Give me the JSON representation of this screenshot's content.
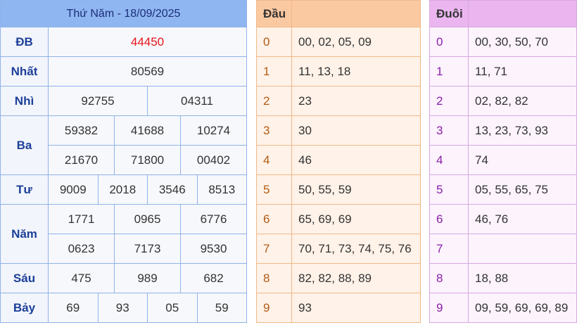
{
  "results": {
    "title": "Thứ Năm - 18/09/2025",
    "rows": [
      {
        "label": "ĐB",
        "values": [
          "44450"
        ]
      },
      {
        "label": "Nhất",
        "values": [
          "80569"
        ]
      },
      {
        "label": "Nhì",
        "values": [
          "92755",
          "04311"
        ]
      },
      {
        "label": "Ba",
        "values": [
          "59382",
          "41688",
          "10274",
          "21670",
          "71800",
          "00402"
        ]
      },
      {
        "label": "Tư",
        "values": [
          "9009",
          "2018",
          "3546",
          "8513"
        ]
      },
      {
        "label": "Năm",
        "values": [
          "1771",
          "0965",
          "6776",
          "0623",
          "7173",
          "9530"
        ]
      },
      {
        "label": "Sáu",
        "values": [
          "475",
          "989",
          "682"
        ]
      },
      {
        "label": "Bảy",
        "values": [
          "69",
          "93",
          "05",
          "59"
        ]
      }
    ]
  },
  "dau": {
    "header": "Đầu",
    "rows": [
      {
        "digit": "0",
        "values": "00, 02, 05, 09"
      },
      {
        "digit": "1",
        "values": "11, 13, 18"
      },
      {
        "digit": "2",
        "values": "23"
      },
      {
        "digit": "3",
        "values": "30"
      },
      {
        "digit": "4",
        "values": "46"
      },
      {
        "digit": "5",
        "values": "50, 55, 59"
      },
      {
        "digit": "6",
        "values": "65, 69, 69"
      },
      {
        "digit": "7",
        "values": "70, 71, 73, 74, 75, 76"
      },
      {
        "digit": "8",
        "values": "82, 82, 88, 89"
      },
      {
        "digit": "9",
        "values": "93"
      }
    ]
  },
  "duoi": {
    "header": "Đuôi",
    "rows": [
      {
        "digit": "0",
        "values": "00, 30, 50, 70"
      },
      {
        "digit": "1",
        "values": "11, 71"
      },
      {
        "digit": "2",
        "values": "02, 82, 82"
      },
      {
        "digit": "3",
        "values": "13, 23, 73, 93"
      },
      {
        "digit": "4",
        "values": "74"
      },
      {
        "digit": "5",
        "values": "05, 55, 65, 75"
      },
      {
        "digit": "6",
        "values": "46, 76"
      },
      {
        "digit": "7",
        "values": ""
      },
      {
        "digit": "8",
        "values": "18, 88"
      },
      {
        "digit": "9",
        "values": "09, 59, 69, 69, 89"
      }
    ]
  }
}
